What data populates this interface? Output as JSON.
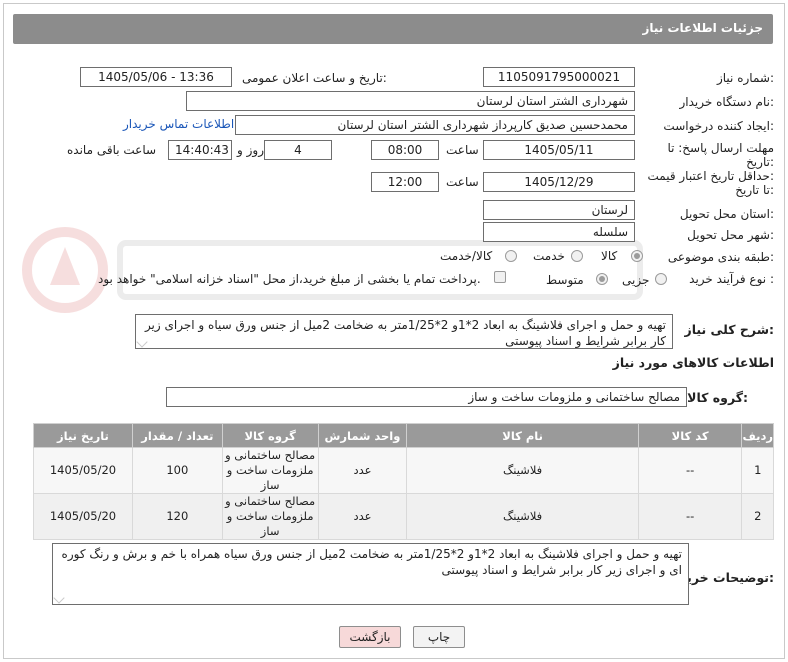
{
  "header": {
    "title": "جزئیات اطلاعات نیاز"
  },
  "fields": {
    "need_number_label": "شماره نیاز:",
    "need_number": "1105091795000021",
    "announce_label": "تاریخ و ساعت اعلان عمومی:",
    "announce_value": "1405/05/06 - 13:36",
    "buyer_org_label": "نام دستگاه خریدار:",
    "buyer_org": "شهرداری الشتر استان لرستان",
    "requester_label": "ایجاد کننده درخواست:",
    "requester": "محمدحسین صدیق کارپرداز شهرداری الشتر استان لرستان",
    "contact_link": "اطلاعات تماس خریدار",
    "reply_deadline_label_1": "مهلت ارسال پاسخ: تا",
    "reply_deadline_label_2": "تاریخ:",
    "reply_date": "1405/05/11",
    "time_label": "ساعت",
    "reply_time": "08:00",
    "days": "4",
    "days_label": "روز و",
    "remaining_time": "14:40:43",
    "remaining_label": "ساعت باقی مانده",
    "price_validity_label_1": "حداقل تاریخ اعتبار قیمت:",
    "price_validity_label_2": "تا تاریخ:",
    "validity_date": "1405/12/29",
    "validity_time": "12:00",
    "province_label": "استان محل تحویل:",
    "province": "لرستان",
    "city_label": "شهر محل تحویل:",
    "city": "سلسله",
    "category_label": "طبقه بندی موضوعی:",
    "category_options": [
      "کالا",
      "خدمت",
      "کالا/خدمت"
    ],
    "process_label": "نوع فرآیند خرید :",
    "process_options": [
      "جزیی",
      "متوسط"
    ],
    "payment_note": "پرداخت تمام یا بخشی از مبلغ خرید،از محل \"اسناد خزانه اسلامی\" خواهد بود.",
    "description_label": "شرح کلی نیاز:",
    "description": "تهیه و حمل و اجرای فلاشینگ به ابعاد 2*1و 2*1/25متر به ضخامت 2میل از جنس ورق سیاه و اجرای زیر کار برابر شرایط و اسناد پیوستی",
    "goods_info_title": "اطلاعات کالاهای مورد نیاز",
    "goods_group_label": "گروه کالا:",
    "goods_group": "مصالح ساختمانی و ملزومات ساخت و ساز",
    "buyer_notes_label": "توضیحات خریدار:",
    "buyer_notes": "تهیه و حمل و اجرای فلاشینگ به ابعاد 2*1و 2*1/25متر به ضخامت 2میل از جنس ورق سیاه  همراه با خم و برش و رنگ کوره ای و اجرای زیر کار برابر شرایط و اسناد پیوستی"
  },
  "table": {
    "headers": [
      "ردیف",
      "کد کالا",
      "نام کالا",
      "واحد شمارش",
      "گروه کالا",
      "تعداد / مقدار",
      "تاریخ نیاز"
    ],
    "rows": [
      {
        "row": "1",
        "code": "--",
        "name": "فلاشینگ",
        "unit": "عدد",
        "group": "مصالح ساختمانی و ملزومات ساخت و ساز",
        "qty": "100",
        "date": "1405/05/20"
      },
      {
        "row": "2",
        "code": "--",
        "name": "فلاشینگ",
        "unit": "عدد",
        "group": "مصالح ساختمانی و ملزومات ساخت و ساز",
        "qty": "120",
        "date": "1405/05/20"
      }
    ]
  },
  "buttons": {
    "print": "چاپ",
    "back": "بازگشت"
  },
  "colors": {
    "header_bg": "#8c8c8c",
    "table_header_bg": "#9a9a9a",
    "link": "#1a56b8",
    "back_button_bg": "#f7d9d9"
  }
}
